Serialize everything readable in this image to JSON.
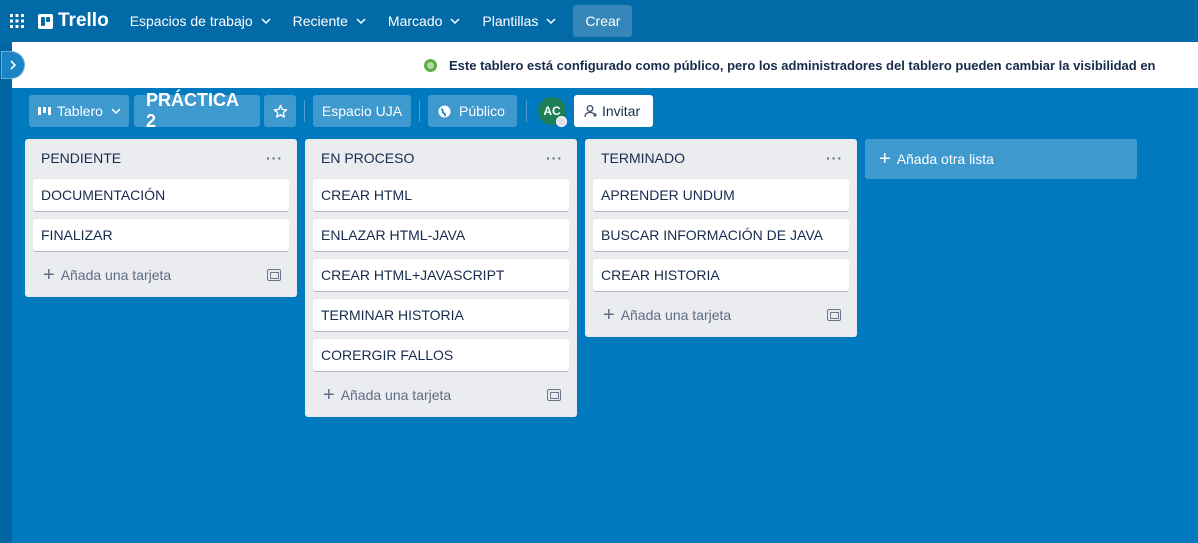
{
  "nav": {
    "logo": "Trello",
    "menus": [
      {
        "label": "Espacios de trabajo"
      },
      {
        "label": "Reciente"
      },
      {
        "label": "Marcado"
      },
      {
        "label": "Plantillas"
      }
    ],
    "create_label": "Crear"
  },
  "banner": {
    "text": "Este tablero está configurado como público, pero los administradores del tablero pueden cambiar la visibilidad en"
  },
  "board": {
    "view_label": "Tablero",
    "title": "PRÁCTICA 2",
    "workspace": "Espacio UJA",
    "visibility": "Público",
    "member_initials": "AC",
    "invite_label": "Invitar"
  },
  "lists": [
    {
      "title": "PENDIENTE",
      "cards": [
        "DOCUMENTACIÓN",
        "FINALIZAR"
      ],
      "add_card_label": "Añada una tarjeta"
    },
    {
      "title": "EN PROCESO",
      "cards": [
        "CREAR HTML",
        "ENLAZAR HTML-JAVA",
        "CREAR HTML+JAVASCRIPT",
        "TERMINAR HISTORIA",
        "CORERGIR FALLOS"
      ],
      "add_card_label": "Añada una tarjeta"
    },
    {
      "title": "TERMINADO",
      "cards": [
        "APRENDER UNDUM",
        "BUSCAR INFORMACIÓN DE JAVA",
        "CREAR HISTORIA"
      ],
      "add_card_label": "Añada una tarjeta"
    }
  ],
  "add_list_label": "Añada otra lista",
  "colors": {
    "board_bg": "#0079bf",
    "nav_bg": "#026aa7",
    "list_bg": "#ebecf0",
    "public_icon": "#5aac44",
    "avatar_bg": "#1d7f55"
  }
}
